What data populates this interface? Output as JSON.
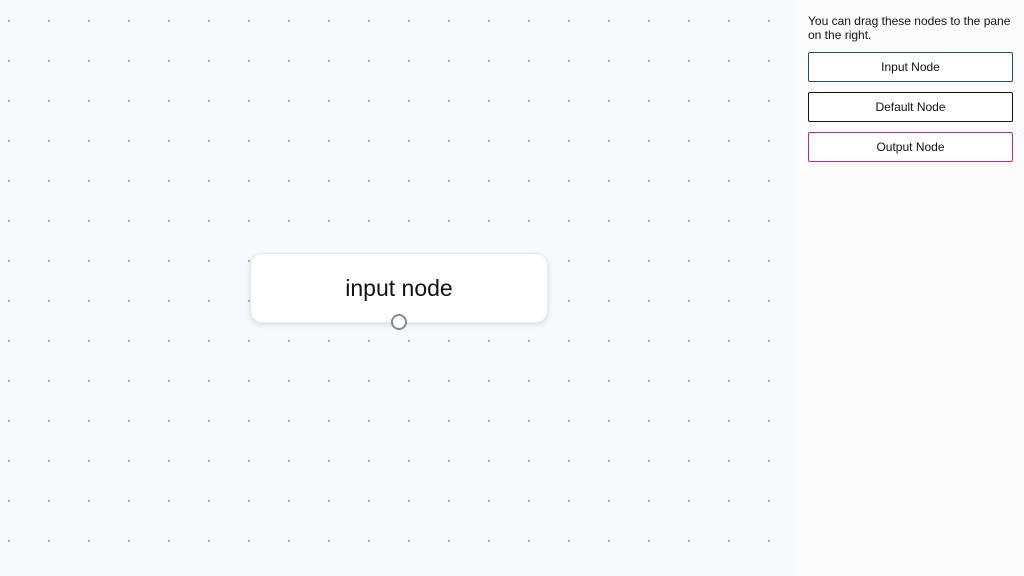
{
  "canvas": {
    "nodes": [
      {
        "label": "input node",
        "type": "input"
      }
    ]
  },
  "sidebar": {
    "description": "You can drag these nodes to the pane on the right.",
    "items": [
      {
        "label": "Input Node",
        "border_color": "#1a4d7a"
      },
      {
        "label": "Default Node",
        "border_color": "#111111"
      },
      {
        "label": "Output Node",
        "border_color": "#c0297e"
      }
    ]
  }
}
